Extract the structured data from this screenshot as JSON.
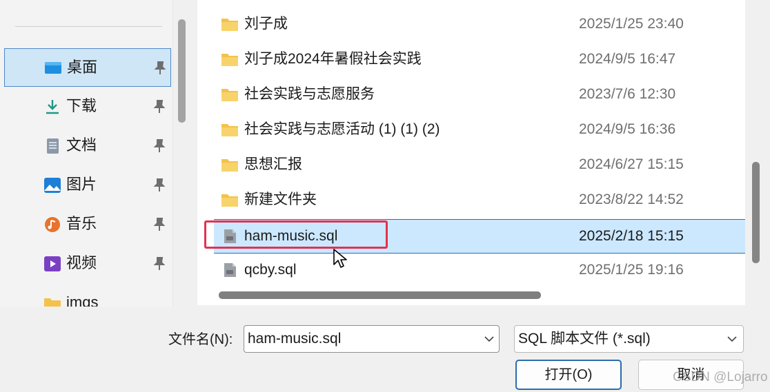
{
  "sidebar": {
    "items": [
      {
        "label": "桌面",
        "icon": "desktop-icon",
        "pinned": true,
        "active": true
      },
      {
        "label": "下载",
        "icon": "download-icon",
        "pinned": true
      },
      {
        "label": "文档",
        "icon": "document-icon",
        "pinned": true
      },
      {
        "label": "图片",
        "icon": "pictures-icon",
        "pinned": true
      },
      {
        "label": "音乐",
        "icon": "music-icon",
        "pinned": true
      },
      {
        "label": "视频",
        "icon": "video-icon",
        "pinned": true
      },
      {
        "label": "imgs",
        "icon": "folder-icon",
        "pinned": false
      }
    ]
  },
  "files": [
    {
      "name": "刘子成",
      "date": "2025/1/25 23:40",
      "type": "folder"
    },
    {
      "name": "刘子成2024年暑假社会实践",
      "date": "2024/9/5 16:47",
      "type": "folder"
    },
    {
      "name": "社会实践与志愿服务",
      "date": "2023/7/6 12:30",
      "type": "folder"
    },
    {
      "name": "社会实践与志愿活动 (1) (1) (2)",
      "date": "2024/9/5 16:36",
      "type": "folder"
    },
    {
      "name": "思想汇报",
      "date": "2024/6/27 15:15",
      "type": "folder"
    },
    {
      "name": "新建文件夹",
      "date": "2023/8/22 14:52",
      "type": "folder"
    },
    {
      "name": "ham-music.sql",
      "date": "2025/2/18 15:15",
      "type": "sql",
      "selected": true
    },
    {
      "name": "qcby.sql",
      "date": "2025/1/25 19:16",
      "type": "sql"
    }
  ],
  "footer": {
    "filename_label": "文件名(N):",
    "filename_value": "ham-music.sql",
    "filetype_value": "SQL 脚本文件 (*.sql)",
    "open_label": "打开(O)",
    "cancel_label": "取消"
  },
  "watermark": "CSDN @Lojarro",
  "colors": {
    "selection": "#cce8ff",
    "selection_border": "#2a6cad",
    "highlight": "#e4304f",
    "folder": "#f3c24a"
  }
}
